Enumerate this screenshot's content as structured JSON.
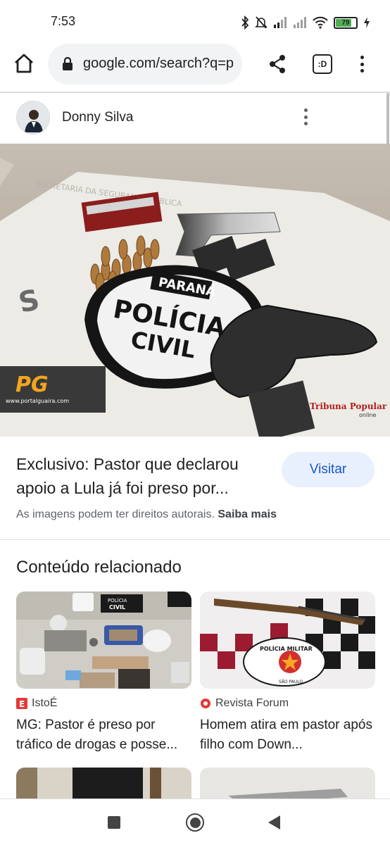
{
  "status_bar": {
    "time": "7:53",
    "battery": "79",
    "battery_percent": 79,
    "icons": [
      "bluetooth-icon",
      "bell-off-icon",
      "signal-icon",
      "signal-icon-2",
      "wifi-icon",
      "battery-icon",
      "charging-icon"
    ]
  },
  "browser": {
    "url": "google.com/search?q=p"
  },
  "author": {
    "name": "Donny Silva"
  },
  "main_image": {
    "text_parana": "PARANÁ",
    "text_policia": "POLÍCIA",
    "text_civil": "CIVIL",
    "watermark_left": "www.portalguaira.com",
    "watermark_right": "Tribuna Popular",
    "watermark_right_sub": "online"
  },
  "result": {
    "title": "Exclusivo: Pastor que declarou apoio a Lula já foi preso por...",
    "visit_label": "Visitar",
    "copyright_text": "As imagens podem ter direitos autorais.",
    "learn_more": "Saiba mais"
  },
  "related": {
    "heading": "Conteúdo relacionado",
    "cards": [
      {
        "source": "IstoÉ",
        "title": "MG: Pastor é preso por tráfico de drogas e posse...",
        "source_icon": "istoe-icon",
        "source_color": "#e53935"
      },
      {
        "source": "Revista Forum",
        "title": "Homem atira em pastor após filho com Down...",
        "source_icon": "forum-icon",
        "source_color": "#e53935"
      }
    ],
    "card1_badge_policia": "POLÍCIA",
    "card1_badge_civil": "CIVIL",
    "card2_badge": "POLÍCIA MILITAR",
    "card2_badge_sub": "SÃO PAULO"
  },
  "colors": {
    "accent_blue": "#1a56c8",
    "visit_bg": "#e8f0fe"
  }
}
